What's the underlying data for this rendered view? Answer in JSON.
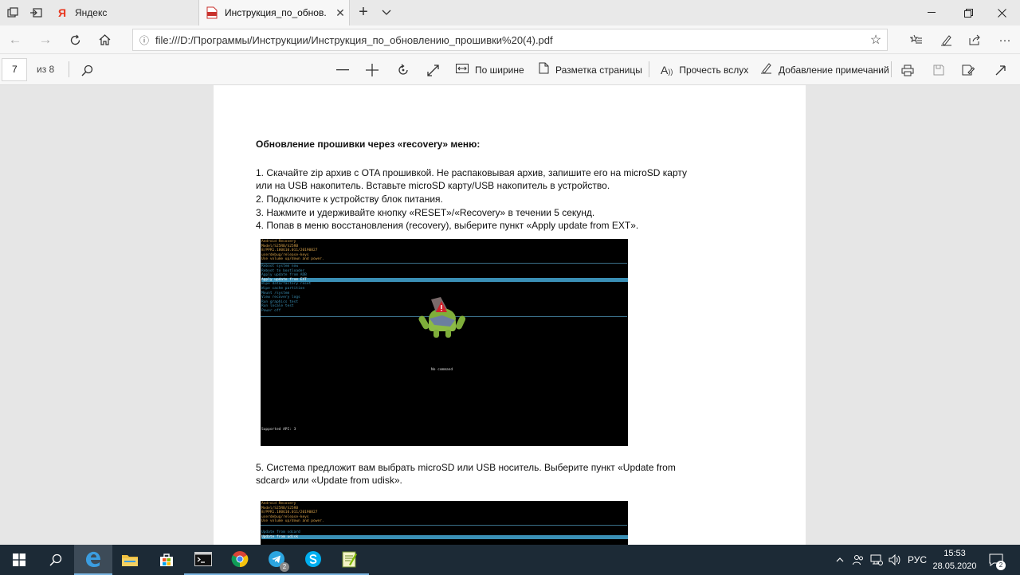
{
  "browser": {
    "tabs": [
      {
        "label": "Яндекс",
        "favicon": "yandex-icon"
      },
      {
        "label": "Инструкция_по_обнов.",
        "favicon": "pdf-icon"
      }
    ],
    "address": "file:///D:/Программы/Инструкции/Инструкция_по_обновлению_прошивки%20(4).pdf"
  },
  "pdf_toolbar": {
    "page_current": "7",
    "page_total": "из 8",
    "fit_width_label": "По ширине",
    "layout_label": "Разметка страницы",
    "read_aloud_label": "Прочесть вслух",
    "add_notes_label": "Добавление примечаний"
  },
  "document": {
    "heading": "Обновление прошивки через «recovery» меню:",
    "lines": [
      "1. Скачайте zip архив с OTA прошивкой. Не распаковывая архив, запишите его на microSD карту",
      "или на USB накопитель. Вставьте microSD карту/USB накопитель в устройство.",
      "2. Подключите к устройству блок питания.",
      "3. Нажмите и удерживайте кнопку «RESET»/«Recovery» в течении 5 секунд.",
      "4. Попав в меню восстановления (recovery), выберите пункт «Apply update from EXT».",
      "5. Система предложит вам выбрать microSD или USB носитель. Выберите пункт «Update from",
      "sdcard» или «Update from udisk»."
    ],
    "screen1": {
      "header": [
        "Android Recovery",
        "Model/S25RB/S25RB",
        "8/PPR1.180610.011/20190827",
        "userdebug/release-keys",
        "Use volume up/down and power."
      ],
      "menu": [
        "Reboot system now",
        "Reboot to bootloader",
        "Apply update from ADB",
        "Apply update from EXT",
        "Wipe data/factory reset",
        "Wipe cache partition",
        "Mount /system",
        "View recovery logs",
        "Run graphics test",
        "Run locale test",
        "Power off"
      ],
      "selected_index": 3,
      "center_text": "No command",
      "footer": "Supported API: 3"
    },
    "screen2": {
      "header": [
        "Android Recovery",
        "Model/S25RB/S25RB",
        "8/PPR1.180610.011/20190827",
        "userdebug/release-keys",
        "Use volume up/down and power."
      ],
      "menu": [
        "Update from sdcard",
        "Update from udisk"
      ],
      "selected_index": 1
    }
  },
  "taskbar": {
    "apps": [
      "start-icon",
      "search-icon",
      "edge-icon",
      "file-explorer-icon",
      "store-icon",
      "terminal-icon",
      "chrome-icon",
      "telegram-icon",
      "skype-icon",
      "notepad-icon"
    ],
    "telegram_badge": "2",
    "language": "РУС",
    "time": "15:53",
    "date": "28.05.2020",
    "notifications": "2"
  },
  "colors": {
    "accent": "#0078d7",
    "recovery_menu": "#3a8fb5",
    "recovery_header": "#d8a24a"
  }
}
